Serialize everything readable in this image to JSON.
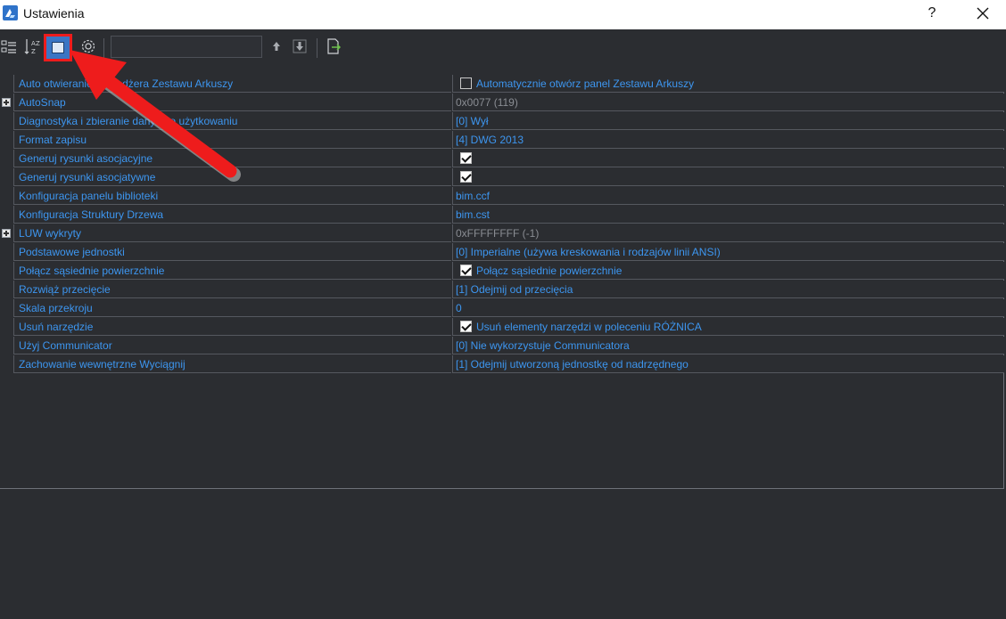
{
  "window": {
    "title": "Ustawienia",
    "help_label": "?"
  },
  "toolbar": {
    "buttons": [
      {
        "icon": "categorized-view-icon"
      },
      {
        "icon": "alphabetical-sort-icon"
      },
      {
        "icon": "panel-view-icon",
        "active": true
      },
      {
        "icon": "gear-icon"
      },
      {
        "icon": "arrow-up-icon"
      },
      {
        "icon": "arrow-down-icon"
      },
      {
        "icon": "export-icon"
      }
    ],
    "search_value": "",
    "highlight_color": "#ee1c1c",
    "accent_color": "#3a75c4"
  },
  "rows": [
    {
      "name": "Auto otwieranie Menedżera Zestawu Arkuszy",
      "value": "Automatycznie otwórz panel Zestawu Arkuszy",
      "checkbox": "unchecked"
    },
    {
      "name": "AutoSnap",
      "value": "0x0077 (119)",
      "expandable": true,
      "grey": true
    },
    {
      "name": "Diagnostyka i zbieranie danych o użytkowaniu",
      "value": "[0] Wył"
    },
    {
      "name": "Format zapisu",
      "value": "[4] DWG 2013"
    },
    {
      "name": "Generuj rysunki asocjacyjne",
      "value": "",
      "checkbox": "checked"
    },
    {
      "name": "Generuj rysunki asocjatywne",
      "value": "",
      "checkbox": "checked"
    },
    {
      "name": "Konfiguracja panelu biblioteki",
      "value": "bim.ccf"
    },
    {
      "name": "Konfiguracja Struktury Drzewa",
      "value": "bim.cst"
    },
    {
      "name": "LUW wykryty",
      "value": "0xFFFFFFFF (-1)",
      "expandable": true,
      "grey": true
    },
    {
      "name": "Podstawowe jednostki",
      "value": "[0] Imperialne (używa kreskowania i rodzajów linii ANSI)"
    },
    {
      "name": "Połącz sąsiednie powierzchnie",
      "value": "Połącz sąsiednie powierzchnie",
      "checkbox": "checked"
    },
    {
      "name": "Rozwiąż przecięcie",
      "value": "[1] Odejmij od przecięcia"
    },
    {
      "name": "Skala przekroju",
      "value": "0"
    },
    {
      "name": "Usuń narzędzie",
      "value": "Usuń elementy narzędzi w poleceniu RÓŻNICA",
      "checkbox": "checked"
    },
    {
      "name": "Użyj Communicator",
      "value": "[0] Nie wykorzystuje Communicatora"
    },
    {
      "name": "Zachowanie wewnętrzne Wyciągnij",
      "value": "[1] Odejmij utworzoną jednostkę od nadrzędnego"
    }
  ]
}
